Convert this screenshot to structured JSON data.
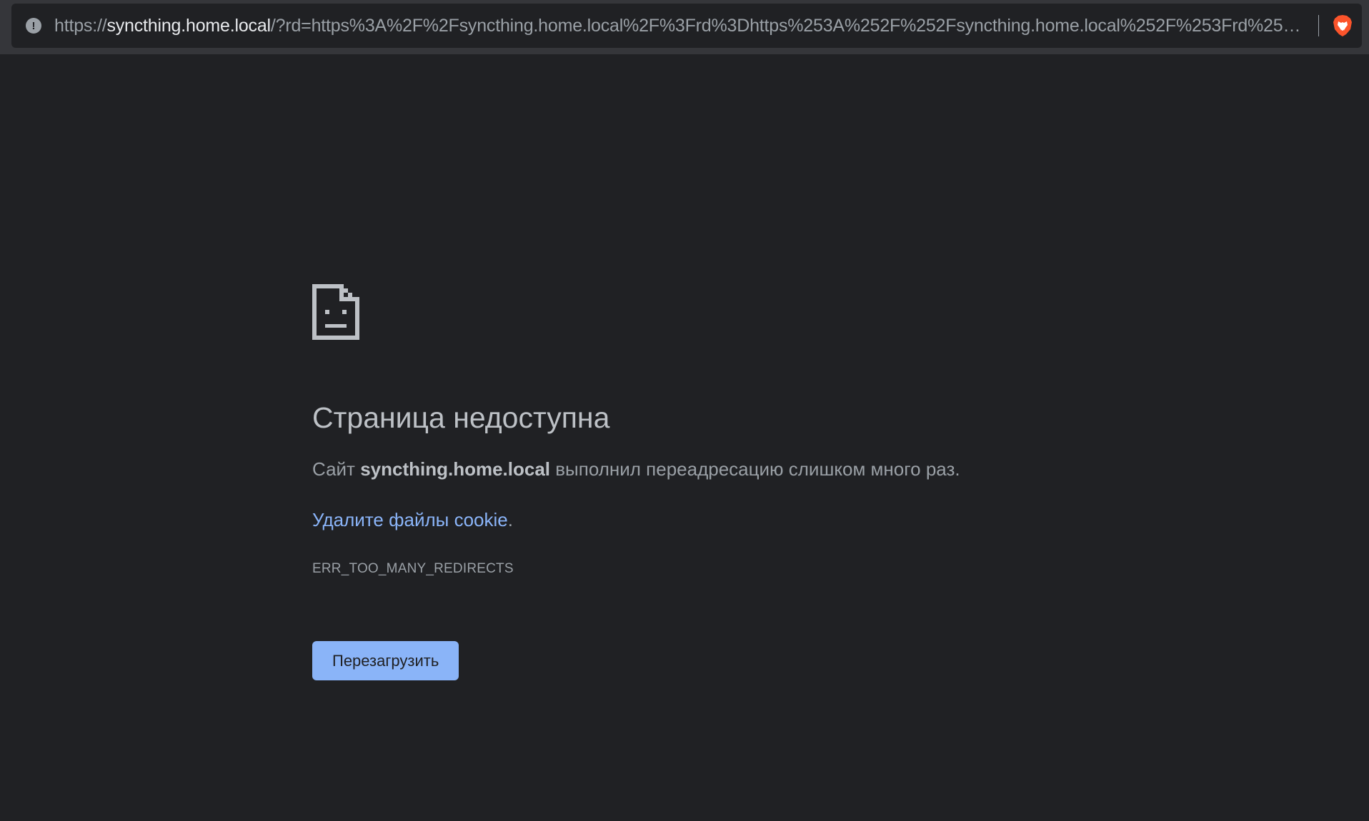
{
  "browser": {
    "url_prefix": "https://",
    "url_host": "syncthing.home.local",
    "url_rest": "/?rd=https%3A%2F%2Fsyncthing.home.local%2F%3Frd%3Dhttps%253A%252F%252Fsyncthing.home.local%252F%253Frd%253Dhtt...",
    "site_info_icon": "info-icon",
    "extension_icon": "brave-lion-icon",
    "extension_icon_color": "#fb542b"
  },
  "error_page": {
    "icon": "sad-page-icon",
    "title": "Страница недоступна",
    "desc_prefix": "Сайт ",
    "desc_host": "syncthing.home.local",
    "desc_suffix": " выполнил переадресацию слишком много раз.",
    "suggestion_link": "Удалите файлы cookie",
    "suggestion_suffix": ".",
    "error_code": "ERR_TOO_MANY_REDIRECTS",
    "reload_label": "Перезагрузить"
  },
  "colors": {
    "background": "#202124",
    "link": "#8ab4f8",
    "button": "#8ab4f8"
  }
}
